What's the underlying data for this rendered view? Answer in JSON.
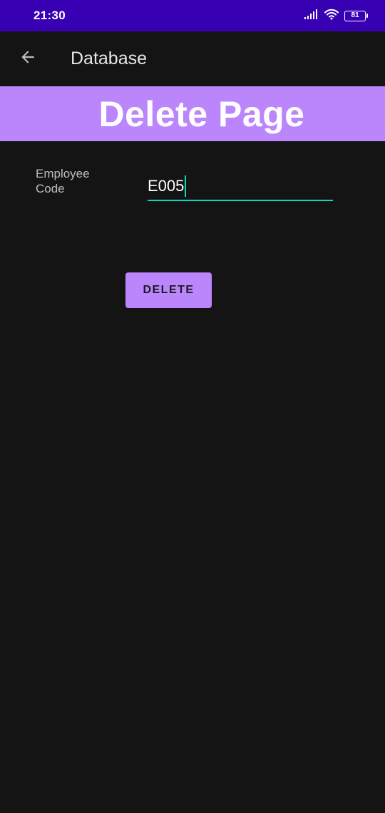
{
  "status_bar": {
    "time": "21:30",
    "battery_level": "81",
    "icons": [
      "signal-icon",
      "wifi-icon",
      "battery-icon"
    ]
  },
  "app_bar": {
    "title": "Database",
    "back_icon": "arrow-back-icon"
  },
  "banner": {
    "text": "Delete Page"
  },
  "form": {
    "employee_code_label": "Employee Code",
    "employee_code_value": "E005"
  },
  "actions": {
    "delete_label": "DELETE"
  },
  "colors": {
    "status_bar": "#3700b3",
    "background": "#141414",
    "accent_purple": "#bb86fc",
    "accent_teal": "#03dac5"
  }
}
